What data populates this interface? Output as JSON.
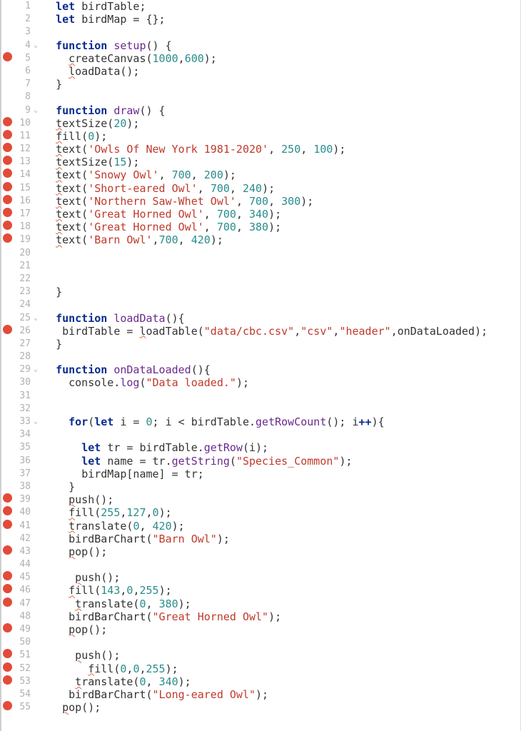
{
  "lines": [
    {
      "n": 1,
      "dot": false,
      "fold": "",
      "indent": "  ",
      "tokens": [
        {
          "t": "let ",
          "c": "kw"
        },
        {
          "t": "birdTable;",
          "c": "fn"
        }
      ]
    },
    {
      "n": 2,
      "dot": false,
      "fold": "",
      "indent": "  ",
      "tokens": [
        {
          "t": "let ",
          "c": "kw"
        },
        {
          "t": "birdMap = {};",
          "c": "fn"
        }
      ]
    },
    {
      "n": 3,
      "dot": false,
      "fold": "",
      "indent": "",
      "tokens": []
    },
    {
      "n": 4,
      "dot": false,
      "fold": "⌄",
      "indent": "  ",
      "tokens": [
        {
          "t": "function ",
          "c": "kw"
        },
        {
          "t": "setup",
          "c": "prop"
        },
        {
          "t": "() {",
          "c": "op"
        }
      ]
    },
    {
      "n": 5,
      "dot": true,
      "fold": "",
      "indent": "    ",
      "tokens": [
        {
          "t": "c",
          "c": "underline-squiggle"
        },
        {
          "t": "reateCanvas(",
          "c": "fn"
        },
        {
          "t": "1000",
          "c": "num"
        },
        {
          "t": ",",
          "c": "op"
        },
        {
          "t": "600",
          "c": "num"
        },
        {
          "t": ");",
          "c": "op"
        }
      ]
    },
    {
      "n": 6,
      "dot": false,
      "fold": "",
      "indent": "    ",
      "tokens": [
        {
          "t": "l",
          "c": "underline-squiggle"
        },
        {
          "t": "oadData();",
          "c": "fn"
        }
      ]
    },
    {
      "n": 7,
      "dot": false,
      "fold": "",
      "indent": "  ",
      "tokens": [
        {
          "t": "}",
          "c": "op"
        }
      ]
    },
    {
      "n": 8,
      "dot": false,
      "fold": "",
      "indent": "",
      "tokens": []
    },
    {
      "n": 9,
      "dot": false,
      "fold": "⌄",
      "indent": "  ",
      "tokens": [
        {
          "t": "function ",
          "c": "kw"
        },
        {
          "t": "draw",
          "c": "prop"
        },
        {
          "t": "() {",
          "c": "op"
        }
      ]
    },
    {
      "n": 10,
      "dot": true,
      "fold": "",
      "indent": "  ",
      "tokens": [
        {
          "t": "t",
          "c": "underline-squiggle"
        },
        {
          "t": "extSize(",
          "c": "fn"
        },
        {
          "t": "20",
          "c": "num"
        },
        {
          "t": ");",
          "c": "op"
        }
      ]
    },
    {
      "n": 11,
      "dot": true,
      "fold": "",
      "indent": "  ",
      "tokens": [
        {
          "t": "f",
          "c": "underline-squiggle"
        },
        {
          "t": "ill(",
          "c": "fn"
        },
        {
          "t": "0",
          "c": "num"
        },
        {
          "t": ");",
          "c": "op"
        }
      ]
    },
    {
      "n": 12,
      "dot": true,
      "fold": "",
      "indent": "  ",
      "tokens": [
        {
          "t": "t",
          "c": "underline-squiggle"
        },
        {
          "t": "ext(",
          "c": "fn"
        },
        {
          "t": "'Owls Of New York 1981-2020'",
          "c": "str"
        },
        {
          "t": ", ",
          "c": "op"
        },
        {
          "t": "250",
          "c": "num"
        },
        {
          "t": ", ",
          "c": "op"
        },
        {
          "t": "100",
          "c": "num"
        },
        {
          "t": ");",
          "c": "op"
        }
      ]
    },
    {
      "n": 13,
      "dot": true,
      "fold": "",
      "indent": "  ",
      "tokens": [
        {
          "t": "t",
          "c": "underline-squiggle"
        },
        {
          "t": "extSize(",
          "c": "fn"
        },
        {
          "t": "15",
          "c": "num"
        },
        {
          "t": ");",
          "c": "op"
        }
      ]
    },
    {
      "n": 14,
      "dot": true,
      "fold": "",
      "indent": "  ",
      "tokens": [
        {
          "t": "t",
          "c": "underline-squiggle"
        },
        {
          "t": "ext(",
          "c": "fn"
        },
        {
          "t": "'Snowy Owl'",
          "c": "str"
        },
        {
          "t": ", ",
          "c": "op"
        },
        {
          "t": "700",
          "c": "num"
        },
        {
          "t": ", ",
          "c": "op"
        },
        {
          "t": "200",
          "c": "num"
        },
        {
          "t": ");",
          "c": "op"
        }
      ]
    },
    {
      "n": 15,
      "dot": true,
      "fold": "",
      "indent": "  ",
      "tokens": [
        {
          "t": "t",
          "c": "underline-squiggle"
        },
        {
          "t": "ext(",
          "c": "fn"
        },
        {
          "t": "'Short-eared Owl'",
          "c": "str"
        },
        {
          "t": ", ",
          "c": "op"
        },
        {
          "t": "700",
          "c": "num"
        },
        {
          "t": ", ",
          "c": "op"
        },
        {
          "t": "240",
          "c": "num"
        },
        {
          "t": ");",
          "c": "op"
        }
      ]
    },
    {
      "n": 16,
      "dot": true,
      "fold": "",
      "indent": "  ",
      "tokens": [
        {
          "t": "t",
          "c": "underline-squiggle"
        },
        {
          "t": "ext(",
          "c": "fn"
        },
        {
          "t": "'Northern Saw-Whet Owl'",
          "c": "str"
        },
        {
          "t": ", ",
          "c": "op"
        },
        {
          "t": "700",
          "c": "num"
        },
        {
          "t": ", ",
          "c": "op"
        },
        {
          "t": "300",
          "c": "num"
        },
        {
          "t": ");",
          "c": "op"
        }
      ]
    },
    {
      "n": 17,
      "dot": true,
      "fold": "",
      "indent": "  ",
      "tokens": [
        {
          "t": "t",
          "c": "underline-squiggle"
        },
        {
          "t": "ext(",
          "c": "fn"
        },
        {
          "t": "'Great Horned Owl'",
          "c": "str"
        },
        {
          "t": ", ",
          "c": "op"
        },
        {
          "t": "700",
          "c": "num"
        },
        {
          "t": ", ",
          "c": "op"
        },
        {
          "t": "340",
          "c": "num"
        },
        {
          "t": ");",
          "c": "op"
        }
      ]
    },
    {
      "n": 18,
      "dot": true,
      "fold": "",
      "indent": "  ",
      "tokens": [
        {
          "t": "t",
          "c": "underline-squiggle"
        },
        {
          "t": "ext(",
          "c": "fn"
        },
        {
          "t": "'Great Horned Owl'",
          "c": "str"
        },
        {
          "t": ", ",
          "c": "op"
        },
        {
          "t": "700",
          "c": "num"
        },
        {
          "t": ", ",
          "c": "op"
        },
        {
          "t": "380",
          "c": "num"
        },
        {
          "t": ");",
          "c": "op"
        }
      ]
    },
    {
      "n": 19,
      "dot": true,
      "fold": "",
      "indent": "  ",
      "tokens": [
        {
          "t": "t",
          "c": "underline-squiggle"
        },
        {
          "t": "ext(",
          "c": "fn"
        },
        {
          "t": "'Barn Owl'",
          "c": "str"
        },
        {
          "t": ",",
          "c": "op"
        },
        {
          "t": "700",
          "c": "num"
        },
        {
          "t": ", ",
          "c": "op"
        },
        {
          "t": "420",
          "c": "num"
        },
        {
          "t": ");",
          "c": "op"
        }
      ]
    },
    {
      "n": 20,
      "dot": false,
      "fold": "",
      "indent": "",
      "tokens": []
    },
    {
      "n": 21,
      "dot": false,
      "fold": "",
      "indent": "",
      "tokens": []
    },
    {
      "n": 22,
      "dot": false,
      "fold": "",
      "indent": "",
      "tokens": []
    },
    {
      "n": 23,
      "dot": false,
      "fold": "",
      "indent": "  ",
      "tokens": [
        {
          "t": "}",
          "c": "op"
        }
      ]
    },
    {
      "n": 24,
      "dot": false,
      "fold": "",
      "indent": "",
      "tokens": []
    },
    {
      "n": 25,
      "dot": false,
      "fold": "⌄",
      "indent": "  ",
      "tokens": [
        {
          "t": "function ",
          "c": "kw"
        },
        {
          "t": "loadData",
          "c": "prop"
        },
        {
          "t": "(){",
          "c": "op"
        }
      ]
    },
    {
      "n": 26,
      "dot": true,
      "fold": "",
      "indent": "   ",
      "tokens": [
        {
          "t": "birdTable = ",
          "c": "fn"
        },
        {
          "t": "l",
          "c": "underline-squiggle"
        },
        {
          "t": "oadTable(",
          "c": "fn"
        },
        {
          "t": "\"data/cbc.csv\"",
          "c": "str"
        },
        {
          "t": ",",
          "c": "op"
        },
        {
          "t": "\"csv\"",
          "c": "str"
        },
        {
          "t": ",",
          "c": "op"
        },
        {
          "t": "\"header\"",
          "c": "str"
        },
        {
          "t": ",onDataLoaded);",
          "c": "fn"
        }
      ]
    },
    {
      "n": 27,
      "dot": false,
      "fold": "",
      "indent": "  ",
      "tokens": [
        {
          "t": "}",
          "c": "op"
        }
      ]
    },
    {
      "n": 28,
      "dot": false,
      "fold": "",
      "indent": "",
      "tokens": []
    },
    {
      "n": 29,
      "dot": false,
      "fold": "⌄",
      "indent": "  ",
      "tokens": [
        {
          "t": "function ",
          "c": "kw"
        },
        {
          "t": "onDataLoaded",
          "c": "prop"
        },
        {
          "t": "(){",
          "c": "op"
        }
      ]
    },
    {
      "n": 30,
      "dot": false,
      "fold": "",
      "indent": "    ",
      "tokens": [
        {
          "t": "console.",
          "c": "fn"
        },
        {
          "t": "log",
          "c": "prop"
        },
        {
          "t": "(",
          "c": "op"
        },
        {
          "t": "\"Data loaded.\"",
          "c": "str"
        },
        {
          "t": ");",
          "c": "op"
        }
      ]
    },
    {
      "n": 31,
      "dot": false,
      "fold": "",
      "indent": "",
      "tokens": []
    },
    {
      "n": 32,
      "dot": false,
      "fold": "",
      "indent": "",
      "tokens": []
    },
    {
      "n": 33,
      "dot": false,
      "fold": "⌄",
      "indent": "    ",
      "tokens": [
        {
          "t": "for",
          "c": "kw"
        },
        {
          "t": "(",
          "c": "op"
        },
        {
          "t": "let ",
          "c": "kw"
        },
        {
          "t": "i = ",
          "c": "fn"
        },
        {
          "t": "0",
          "c": "num"
        },
        {
          "t": "; i < birdTable.",
          "c": "fn"
        },
        {
          "t": "getRowCount",
          "c": "prop"
        },
        {
          "t": "(); i",
          "c": "fn"
        },
        {
          "t": "++",
          "c": "kw"
        },
        {
          "t": "){",
          "c": "op"
        }
      ]
    },
    {
      "n": 34,
      "dot": false,
      "fold": "",
      "indent": "",
      "tokens": []
    },
    {
      "n": 35,
      "dot": false,
      "fold": "",
      "indent": "      ",
      "tokens": [
        {
          "t": "let ",
          "c": "kw"
        },
        {
          "t": "tr = birdTable.",
          "c": "fn"
        },
        {
          "t": "getRow",
          "c": "prop"
        },
        {
          "t": "(i);",
          "c": "fn"
        }
      ]
    },
    {
      "n": 36,
      "dot": false,
      "fold": "",
      "indent": "      ",
      "tokens": [
        {
          "t": "let ",
          "c": "kw"
        },
        {
          "t": "name = tr.",
          "c": "fn"
        },
        {
          "t": "getString",
          "c": "prop"
        },
        {
          "t": "(",
          "c": "op"
        },
        {
          "t": "\"Species_Common\"",
          "c": "str"
        },
        {
          "t": ");",
          "c": "op"
        }
      ]
    },
    {
      "n": 37,
      "dot": false,
      "fold": "",
      "indent": "      ",
      "tokens": [
        {
          "t": "birdMap[name] = tr;",
          "c": "fn"
        }
      ]
    },
    {
      "n": 38,
      "dot": false,
      "fold": "",
      "indent": "    ",
      "tokens": [
        {
          "t": "}",
          "c": "op"
        }
      ]
    },
    {
      "n": 39,
      "dot": true,
      "fold": "",
      "indent": "    ",
      "tokens": [
        {
          "t": "p",
          "c": "underline-squiggle"
        },
        {
          "t": "ush();",
          "c": "fn"
        }
      ]
    },
    {
      "n": 40,
      "dot": true,
      "fold": "",
      "indent": "    ",
      "tokens": [
        {
          "t": "f",
          "c": "underline-squiggle"
        },
        {
          "t": "ill(",
          "c": "fn"
        },
        {
          "t": "255",
          "c": "num"
        },
        {
          "t": ",",
          "c": "op"
        },
        {
          "t": "127",
          "c": "num"
        },
        {
          "t": ",",
          "c": "op"
        },
        {
          "t": "0",
          "c": "num"
        },
        {
          "t": ");",
          "c": "op"
        }
      ]
    },
    {
      "n": 41,
      "dot": true,
      "fold": "",
      "indent": "    ",
      "tokens": [
        {
          "t": "t",
          "c": "underline-squiggle"
        },
        {
          "t": "ranslate(",
          "c": "fn"
        },
        {
          "t": "0",
          "c": "num"
        },
        {
          "t": ", ",
          "c": "op"
        },
        {
          "t": "420",
          "c": "num"
        },
        {
          "t": ");",
          "c": "op"
        }
      ]
    },
    {
      "n": 42,
      "dot": false,
      "fold": "",
      "indent": "    ",
      "tokens": [
        {
          "t": "birdBarChart(",
          "c": "fn"
        },
        {
          "t": "\"Barn Owl\"",
          "c": "str"
        },
        {
          "t": ");",
          "c": "op"
        }
      ]
    },
    {
      "n": 43,
      "dot": true,
      "fold": "",
      "indent": "    ",
      "tokens": [
        {
          "t": "p",
          "c": "underline-squiggle"
        },
        {
          "t": "op();",
          "c": "fn"
        }
      ]
    },
    {
      "n": 44,
      "dot": false,
      "fold": "",
      "indent": "",
      "tokens": []
    },
    {
      "n": 45,
      "dot": true,
      "fold": "",
      "indent": "     ",
      "tokens": [
        {
          "t": "p",
          "c": "underline-squiggle"
        },
        {
          "t": "ush();",
          "c": "fn"
        }
      ]
    },
    {
      "n": 46,
      "dot": true,
      "fold": "",
      "indent": "    ",
      "tokens": [
        {
          "t": "f",
          "c": "underline-squiggle"
        },
        {
          "t": "ill(",
          "c": "fn"
        },
        {
          "t": "143",
          "c": "num"
        },
        {
          "t": ",",
          "c": "op"
        },
        {
          "t": "0",
          "c": "num"
        },
        {
          "t": ",",
          "c": "op"
        },
        {
          "t": "255",
          "c": "num"
        },
        {
          "t": ");",
          "c": "op"
        }
      ]
    },
    {
      "n": 47,
      "dot": true,
      "fold": "",
      "indent": "     ",
      "tokens": [
        {
          "t": "t",
          "c": "underline-squiggle"
        },
        {
          "t": "ranslate(",
          "c": "fn"
        },
        {
          "t": "0",
          "c": "num"
        },
        {
          "t": ", ",
          "c": "op"
        },
        {
          "t": "380",
          "c": "num"
        },
        {
          "t": ");",
          "c": "op"
        }
      ]
    },
    {
      "n": 48,
      "dot": false,
      "fold": "",
      "indent": "    ",
      "tokens": [
        {
          "t": "birdBarChart(",
          "c": "fn"
        },
        {
          "t": "\"Great Horned Owl\"",
          "c": "str"
        },
        {
          "t": ");",
          "c": "op"
        }
      ]
    },
    {
      "n": 49,
      "dot": true,
      "fold": "",
      "indent": "    ",
      "tokens": [
        {
          "t": "p",
          "c": "underline-squiggle"
        },
        {
          "t": "op();",
          "c": "fn"
        }
      ]
    },
    {
      "n": 50,
      "dot": false,
      "fold": "",
      "indent": "",
      "tokens": []
    },
    {
      "n": 51,
      "dot": true,
      "fold": "",
      "indent": "     ",
      "tokens": [
        {
          "t": "p",
          "c": "underline-squiggle"
        },
        {
          "t": "ush();",
          "c": "fn"
        }
      ]
    },
    {
      "n": 52,
      "dot": true,
      "fold": "",
      "indent": "       ",
      "tokens": [
        {
          "t": "f",
          "c": "underline-squiggle"
        },
        {
          "t": "ill(",
          "c": "fn"
        },
        {
          "t": "0",
          "c": "num"
        },
        {
          "t": ",",
          "c": "op"
        },
        {
          "t": "0",
          "c": "num"
        },
        {
          "t": ",",
          "c": "op"
        },
        {
          "t": "255",
          "c": "num"
        },
        {
          "t": ");",
          "c": "op"
        }
      ]
    },
    {
      "n": 53,
      "dot": true,
      "fold": "",
      "indent": "     ",
      "tokens": [
        {
          "t": "t",
          "c": "underline-squiggle"
        },
        {
          "t": "ranslate(",
          "c": "fn"
        },
        {
          "t": "0",
          "c": "num"
        },
        {
          "t": ", ",
          "c": "op"
        },
        {
          "t": "340",
          "c": "num"
        },
        {
          "t": ");",
          "c": "op"
        }
      ]
    },
    {
      "n": 54,
      "dot": false,
      "fold": "",
      "indent": "    ",
      "tokens": [
        {
          "t": "birdBarChart(",
          "c": "fn"
        },
        {
          "t": "\"Long-eared Owl\"",
          "c": "str"
        },
        {
          "t": ");",
          "c": "op"
        }
      ]
    },
    {
      "n": 55,
      "dot": true,
      "fold": "",
      "indent": "   ",
      "tokens": [
        {
          "t": "p",
          "c": "underline-squiggle"
        },
        {
          "t": "op();",
          "c": "fn"
        }
      ]
    }
  ]
}
